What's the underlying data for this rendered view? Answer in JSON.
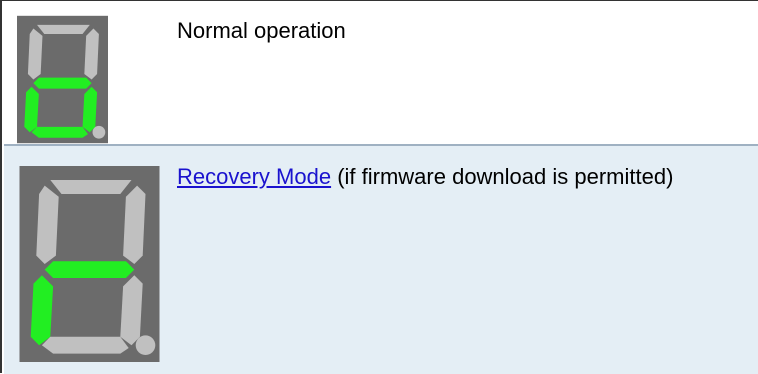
{
  "colors": {
    "panel": "#6b6b6b",
    "segment_off": "#c0c0c0",
    "segment_on": "#22ee22",
    "row_alt_bg": "#e4eef5",
    "link": "#1a12ce"
  },
  "rows": [
    {
      "display_icon": "seven-segment-o-icon",
      "lit_segments": [
        "c",
        "d",
        "e",
        "g"
      ],
      "description": "Normal operation"
    },
    {
      "display_icon": "seven-segment-r-icon",
      "lit_segments": [
        "e",
        "g"
      ],
      "link_text": "Recovery Mode",
      "description_suffix": " (if firmware download is permitted)"
    }
  ]
}
